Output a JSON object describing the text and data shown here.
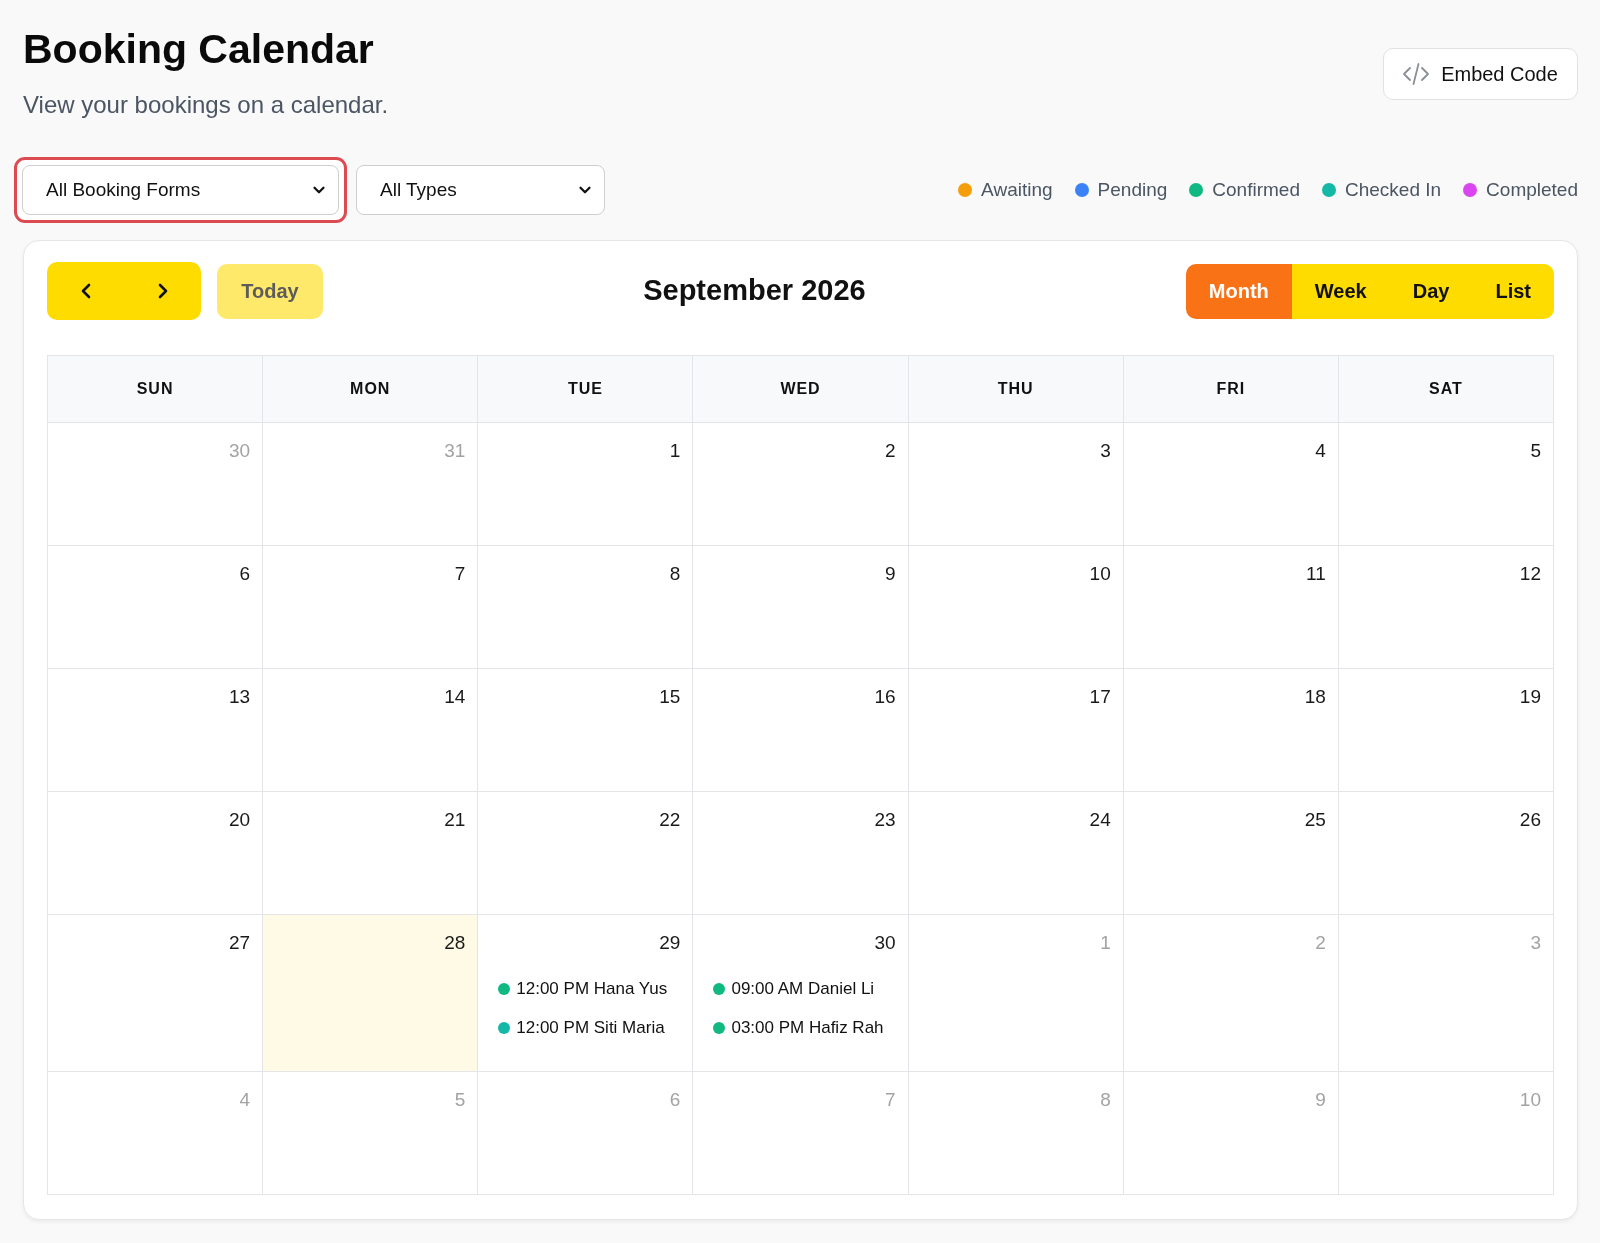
{
  "page": {
    "title": "Booking Calendar",
    "subtitle": "View your bookings on a calendar."
  },
  "embed_button": {
    "label": "Embed Code"
  },
  "filters": [
    {
      "value": "All Booking Forms",
      "focused": true
    },
    {
      "value": "All Types",
      "focused": false
    }
  ],
  "legend": [
    {
      "label": "Awaiting",
      "color": "#f59e0b"
    },
    {
      "label": "Pending",
      "color": "#3b82f6"
    },
    {
      "label": "Confirmed",
      "color": "#10b981"
    },
    {
      "label": "Checked In",
      "color": "#14b8a6"
    },
    {
      "label": "Completed",
      "color": "#d946ef"
    }
  ],
  "calendar": {
    "title": "September 2026",
    "today_button": {
      "label": "Today",
      "disabled": true
    },
    "views": [
      {
        "label": "Month",
        "selected": true
      },
      {
        "label": "Week",
        "selected": false
      },
      {
        "label": "Day",
        "selected": false
      },
      {
        "label": "List",
        "selected": false
      }
    ],
    "weekdays": [
      "SUN",
      "MON",
      "TUE",
      "WED",
      "THU",
      "FRI",
      "SAT"
    ],
    "weeks": [
      [
        {
          "day": "30",
          "muted": true,
          "today": false
        },
        {
          "day": "31",
          "muted": true,
          "today": false
        },
        {
          "day": "1",
          "muted": false,
          "today": false
        },
        {
          "day": "2",
          "muted": false,
          "today": false
        },
        {
          "day": "3",
          "muted": false,
          "today": false
        },
        {
          "day": "4",
          "muted": false,
          "today": false
        },
        {
          "day": "5",
          "muted": false,
          "today": false
        }
      ],
      [
        {
          "day": "6",
          "muted": false,
          "today": false
        },
        {
          "day": "7",
          "muted": false,
          "today": false
        },
        {
          "day": "8",
          "muted": false,
          "today": false
        },
        {
          "day": "9",
          "muted": false,
          "today": false
        },
        {
          "day": "10",
          "muted": false,
          "today": false
        },
        {
          "day": "11",
          "muted": false,
          "today": false
        },
        {
          "day": "12",
          "muted": false,
          "today": false
        }
      ],
      [
        {
          "day": "13",
          "muted": false,
          "today": false
        },
        {
          "day": "14",
          "muted": false,
          "today": false
        },
        {
          "day": "15",
          "muted": false,
          "today": false
        },
        {
          "day": "16",
          "muted": false,
          "today": false
        },
        {
          "day": "17",
          "muted": false,
          "today": false
        },
        {
          "day": "18",
          "muted": false,
          "today": false
        },
        {
          "day": "19",
          "muted": false,
          "today": false
        }
      ],
      [
        {
          "day": "20",
          "muted": false,
          "today": false
        },
        {
          "day": "21",
          "muted": false,
          "today": false
        },
        {
          "day": "22",
          "muted": false,
          "today": false
        },
        {
          "day": "23",
          "muted": false,
          "today": false
        },
        {
          "day": "24",
          "muted": false,
          "today": false
        },
        {
          "day": "25",
          "muted": false,
          "today": false
        },
        {
          "day": "26",
          "muted": false,
          "today": false
        }
      ],
      [
        {
          "day": "27",
          "muted": false,
          "today": false
        },
        {
          "day": "28",
          "muted": false,
          "today": true
        },
        {
          "day": "29",
          "muted": false,
          "today": false,
          "events": [
            {
              "label": "12:00 PM Hana Yus",
              "color": "#10b981"
            },
            {
              "label": "12:00 PM Siti Maria",
              "color": "#14b8a6"
            }
          ]
        },
        {
          "day": "30",
          "muted": false,
          "today": false,
          "events": [
            {
              "label": "09:00 AM Daniel Li",
              "color": "#10b981"
            },
            {
              "label": "03:00 PM Hafiz Rah",
              "color": "#10b981"
            }
          ]
        },
        {
          "day": "1",
          "muted": true,
          "today": false
        },
        {
          "day": "2",
          "muted": true,
          "today": false
        },
        {
          "day": "3",
          "muted": true,
          "today": false
        }
      ],
      [
        {
          "day": "4",
          "muted": true,
          "today": false
        },
        {
          "day": "5",
          "muted": true,
          "today": false
        },
        {
          "day": "6",
          "muted": true,
          "today": false
        },
        {
          "day": "7",
          "muted": true,
          "today": false
        },
        {
          "day": "8",
          "muted": true,
          "today": false
        },
        {
          "day": "9",
          "muted": true,
          "today": false
        },
        {
          "day": "10",
          "muted": true,
          "today": false
        }
      ]
    ]
  }
}
